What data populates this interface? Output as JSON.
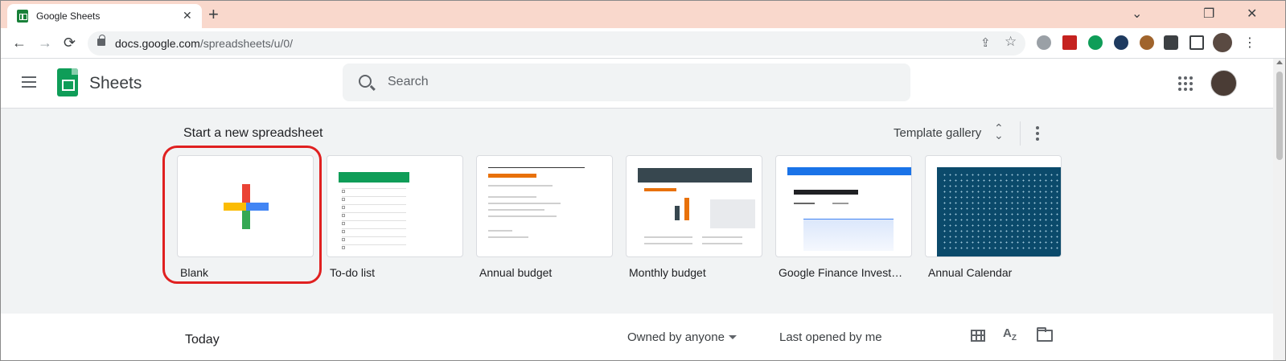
{
  "browser": {
    "tab_title": "Google Sheets",
    "tab_close": "✕",
    "new_tab": "+",
    "url_host": "docs.google.com",
    "url_path": "/spreadsheets/u/0/",
    "window_controls": [
      "⌄",
      "❐",
      "✕"
    ],
    "back": "←",
    "forward": "→",
    "reload": "⟳",
    "share": "⇪",
    "star": "☆"
  },
  "app": {
    "name": "Sheets",
    "search_placeholder": "Search"
  },
  "templates": {
    "section_title": "Start a new spreadsheet",
    "gallery_label": "Template gallery",
    "unfold_glyph": "⌃⌄",
    "items": [
      {
        "label": "Blank"
      },
      {
        "label": "To-do list"
      },
      {
        "label": "Annual budget"
      },
      {
        "label": "Monthly budget"
      },
      {
        "label": "Google Finance Investment Tracker"
      },
      {
        "label": "Annual Calendar"
      }
    ]
  },
  "recent": {
    "today": "Today",
    "owned_filter": "Owned by anyone",
    "sort_label": "Last opened by me",
    "sort_glyph": "A͢Z"
  },
  "colors": {
    "tab_strip": "#f9d8cc",
    "sheets_green": "#0f9d58",
    "highlight_red": "#e02020"
  }
}
